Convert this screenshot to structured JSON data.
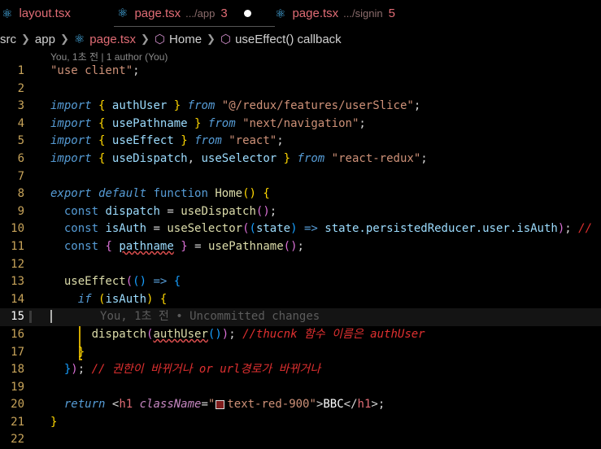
{
  "tabs": [
    {
      "name": "layout.tsx",
      "dir": "",
      "problems": ""
    },
    {
      "name": "page.tsx",
      "dir": ".../app",
      "problems": "3"
    },
    {
      "name": "page.tsx",
      "dir": ".../signin",
      "problems": "5"
    }
  ],
  "breadcrumb": {
    "seg1": "src",
    "seg2": "app",
    "seg3": "page.tsx",
    "seg4": "Home",
    "seg5": "useEffect() callback"
  },
  "codelens": "You, 1초 전 | 1 author (You)",
  "line_numbers": [
    "1",
    "2",
    "3",
    "4",
    "5",
    "6",
    "7",
    "8",
    "9",
    "10",
    "11",
    "12",
    "13",
    "14",
    "15",
    "16",
    "17",
    "18",
    "19",
    "20",
    "21",
    "22"
  ],
  "code": {
    "l1": "\"use client\"",
    "l1_end": ";",
    "import": "import",
    "from": "from",
    "l3_name": "authUser",
    "l3_src": "\"@/redux/features/userSlice\"",
    "l4_name": "usePathname",
    "l4_src": "\"next/navigation\"",
    "l5_name": "useEffect",
    "l5_src": "\"react\"",
    "l6_name1": "useDispatch",
    "l6_name2": "useSelector",
    "l6_src": "\"react-redux\"",
    "export": "export",
    "default": "default",
    "function": "function",
    "home": "Home",
    "const": "const",
    "dispatch": "dispatch",
    "useDispatch": "useDispatch",
    "isAuth": "isAuth",
    "useSelector": "useSelector",
    "state": "state",
    "arrow": "=>",
    "state_path": "state.persistedReducer.user.isAuth",
    "l10_tail": "//",
    "pathname": "pathname",
    "usePathname": "usePathname",
    "useEffect": "useEffect",
    "if": "if",
    "ghost_text": "You, 1초 전 • Uncommitted changes",
    "authUser": "authUser",
    "l16_comment": "//thucnk 함수 이름은 authUser",
    "l18_comment": "// 권한이 바뀌거나 or url경로가 바뀌거나",
    "return": "return",
    "h1": "h1",
    "className": "className",
    "class_value": "text-red-900",
    "h1_text": "BBC"
  },
  "colors": {
    "background": "#000000",
    "line_number": "#c8a45a",
    "string": "#ce9178",
    "keyword": "#569cd6",
    "function": "#dcdcaa",
    "variable": "#9cdcfe",
    "comment": "#e03030",
    "bracket_gold": "#ffd700",
    "bracket_purple": "#da70d6",
    "bracket_blue": "#179fff"
  },
  "icons": {
    "react": "react-icon",
    "symbol": "method-cube-icon",
    "modified": "unsaved-dot-icon"
  }
}
